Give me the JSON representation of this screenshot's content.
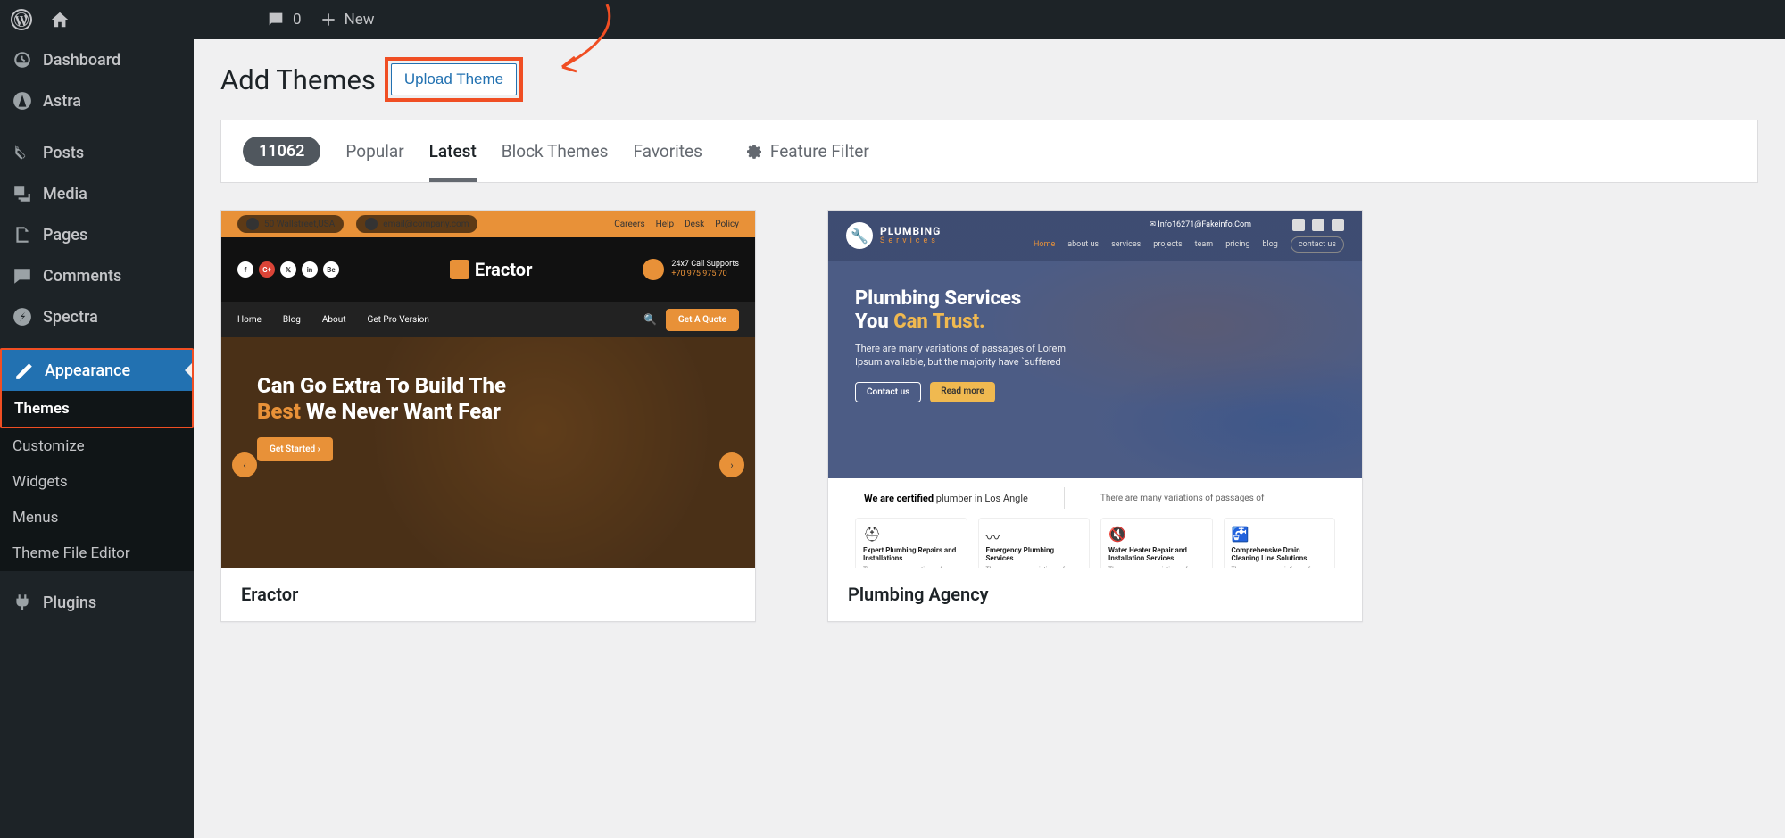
{
  "adminBar": {
    "comments": "0",
    "newLabel": "New"
  },
  "sidebar": {
    "dashboard": "Dashboard",
    "astra": "Astra",
    "posts": "Posts",
    "media": "Media",
    "pages": "Pages",
    "comments": "Comments",
    "spectra": "Spectra",
    "appearance": "Appearance",
    "plugins": "Plugins",
    "sub": {
      "themes": "Themes",
      "customize": "Customize",
      "widgets": "Widgets",
      "menus": "Menus",
      "editor": "Theme File Editor"
    }
  },
  "header": {
    "title": "Add Themes",
    "uploadBtn": "Upload Theme"
  },
  "filter": {
    "count": "11062",
    "popular": "Popular",
    "latest": "Latest",
    "blockthemes": "Block Themes",
    "favorites": "Favorites",
    "featurefilter": "Feature Filter"
  },
  "themes": [
    {
      "name": "Eractor"
    },
    {
      "name": "Plumbing Agency"
    }
  ],
  "eractor": {
    "address": "50 Wallstreet,USA",
    "email": "email@company.com",
    "toplinks": [
      "Careers",
      "Help",
      "Desk",
      "Policy"
    ],
    "logo": "Eractor",
    "callTitle": "24x7 Call Supports",
    "callNum": "+70 975 975 70",
    "nav": [
      "Home",
      "Blog",
      "About",
      "Get Pro Version"
    ],
    "quote": "Get A Quote",
    "heroLine1": "Can Go Extra To Build The",
    "heroBest": "Best",
    "heroLine2": " We Never Want Fear",
    "getStarted": "Get Started"
  },
  "plumbing": {
    "logoTitle": "PLUMBING",
    "logoSub": "Services",
    "email": "Info16271@Fakeinfo.Com",
    "nav": [
      "Home",
      "about us",
      "services",
      "projects",
      "team",
      "pricing",
      "blog"
    ],
    "contact": "contact us",
    "h1a": "Plumbing Services",
    "h1b": "You ",
    "h1c": "Can Trust.",
    "desc": "There are many variations of passages of Lorem Ipsum available, but the majority have `suffered",
    "btn1": "Contact us",
    "btn2": "Read more",
    "certBold": "We are certified",
    "certRest": " plumber in Los Angle",
    "certSub": "There are many variations of passages of",
    "cards": [
      {
        "icon": "⛑",
        "title": "Expert Plumbing Repairs and Installations",
        "desc": "There are many variations of passages of Lorem"
      },
      {
        "icon": "〰",
        "title": "Emergency Plumbing Services",
        "desc": "There are many variations of passages of Lorem"
      },
      {
        "icon": "🔇",
        "title": "Water Heater Repair and Installation Services",
        "desc": "There are many variations of passages of Lorem"
      },
      {
        "icon": "🚰",
        "title": "Comprehensive Drain Cleaning Line Solutions",
        "desc": "There are many variations of passages of Lorem"
      }
    ]
  }
}
